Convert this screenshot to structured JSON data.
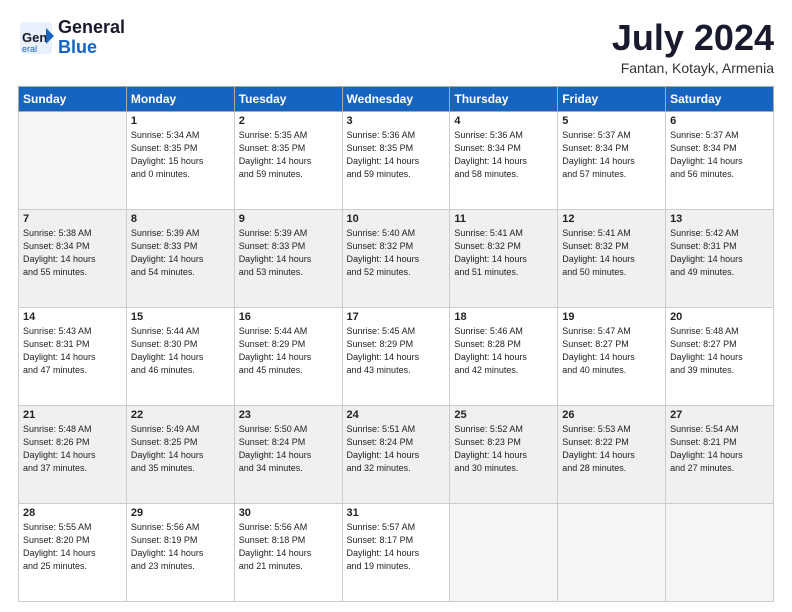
{
  "header": {
    "logo_line1": "General",
    "logo_line2": "Blue",
    "month": "July 2024",
    "location": "Fantan, Kotayk, Armenia"
  },
  "weekdays": [
    "Sunday",
    "Monday",
    "Tuesday",
    "Wednesday",
    "Thursday",
    "Friday",
    "Saturday"
  ],
  "weeks": [
    [
      {
        "day": "",
        "info": ""
      },
      {
        "day": "1",
        "info": "Sunrise: 5:34 AM\nSunset: 8:35 PM\nDaylight: 15 hours\nand 0 minutes."
      },
      {
        "day": "2",
        "info": "Sunrise: 5:35 AM\nSunset: 8:35 PM\nDaylight: 14 hours\nand 59 minutes."
      },
      {
        "day": "3",
        "info": "Sunrise: 5:36 AM\nSunset: 8:35 PM\nDaylight: 14 hours\nand 59 minutes."
      },
      {
        "day": "4",
        "info": "Sunrise: 5:36 AM\nSunset: 8:34 PM\nDaylight: 14 hours\nand 58 minutes."
      },
      {
        "day": "5",
        "info": "Sunrise: 5:37 AM\nSunset: 8:34 PM\nDaylight: 14 hours\nand 57 minutes."
      },
      {
        "day": "6",
        "info": "Sunrise: 5:37 AM\nSunset: 8:34 PM\nDaylight: 14 hours\nand 56 minutes."
      }
    ],
    [
      {
        "day": "7",
        "info": "Sunrise: 5:38 AM\nSunset: 8:34 PM\nDaylight: 14 hours\nand 55 minutes."
      },
      {
        "day": "8",
        "info": "Sunrise: 5:39 AM\nSunset: 8:33 PM\nDaylight: 14 hours\nand 54 minutes."
      },
      {
        "day": "9",
        "info": "Sunrise: 5:39 AM\nSunset: 8:33 PM\nDaylight: 14 hours\nand 53 minutes."
      },
      {
        "day": "10",
        "info": "Sunrise: 5:40 AM\nSunset: 8:32 PM\nDaylight: 14 hours\nand 52 minutes."
      },
      {
        "day": "11",
        "info": "Sunrise: 5:41 AM\nSunset: 8:32 PM\nDaylight: 14 hours\nand 51 minutes."
      },
      {
        "day": "12",
        "info": "Sunrise: 5:41 AM\nSunset: 8:32 PM\nDaylight: 14 hours\nand 50 minutes."
      },
      {
        "day": "13",
        "info": "Sunrise: 5:42 AM\nSunset: 8:31 PM\nDaylight: 14 hours\nand 49 minutes."
      }
    ],
    [
      {
        "day": "14",
        "info": "Sunrise: 5:43 AM\nSunset: 8:31 PM\nDaylight: 14 hours\nand 47 minutes."
      },
      {
        "day": "15",
        "info": "Sunrise: 5:44 AM\nSunset: 8:30 PM\nDaylight: 14 hours\nand 46 minutes."
      },
      {
        "day": "16",
        "info": "Sunrise: 5:44 AM\nSunset: 8:29 PM\nDaylight: 14 hours\nand 45 minutes."
      },
      {
        "day": "17",
        "info": "Sunrise: 5:45 AM\nSunset: 8:29 PM\nDaylight: 14 hours\nand 43 minutes."
      },
      {
        "day": "18",
        "info": "Sunrise: 5:46 AM\nSunset: 8:28 PM\nDaylight: 14 hours\nand 42 minutes."
      },
      {
        "day": "19",
        "info": "Sunrise: 5:47 AM\nSunset: 8:27 PM\nDaylight: 14 hours\nand 40 minutes."
      },
      {
        "day": "20",
        "info": "Sunrise: 5:48 AM\nSunset: 8:27 PM\nDaylight: 14 hours\nand 39 minutes."
      }
    ],
    [
      {
        "day": "21",
        "info": "Sunrise: 5:48 AM\nSunset: 8:26 PM\nDaylight: 14 hours\nand 37 minutes."
      },
      {
        "day": "22",
        "info": "Sunrise: 5:49 AM\nSunset: 8:25 PM\nDaylight: 14 hours\nand 35 minutes."
      },
      {
        "day": "23",
        "info": "Sunrise: 5:50 AM\nSunset: 8:24 PM\nDaylight: 14 hours\nand 34 minutes."
      },
      {
        "day": "24",
        "info": "Sunrise: 5:51 AM\nSunset: 8:24 PM\nDaylight: 14 hours\nand 32 minutes."
      },
      {
        "day": "25",
        "info": "Sunrise: 5:52 AM\nSunset: 8:23 PM\nDaylight: 14 hours\nand 30 minutes."
      },
      {
        "day": "26",
        "info": "Sunrise: 5:53 AM\nSunset: 8:22 PM\nDaylight: 14 hours\nand 28 minutes."
      },
      {
        "day": "27",
        "info": "Sunrise: 5:54 AM\nSunset: 8:21 PM\nDaylight: 14 hours\nand 27 minutes."
      }
    ],
    [
      {
        "day": "28",
        "info": "Sunrise: 5:55 AM\nSunset: 8:20 PM\nDaylight: 14 hours\nand 25 minutes."
      },
      {
        "day": "29",
        "info": "Sunrise: 5:56 AM\nSunset: 8:19 PM\nDaylight: 14 hours\nand 23 minutes."
      },
      {
        "day": "30",
        "info": "Sunrise: 5:56 AM\nSunset: 8:18 PM\nDaylight: 14 hours\nand 21 minutes."
      },
      {
        "day": "31",
        "info": "Sunrise: 5:57 AM\nSunset: 8:17 PM\nDaylight: 14 hours\nand 19 minutes."
      },
      {
        "day": "",
        "info": ""
      },
      {
        "day": "",
        "info": ""
      },
      {
        "day": "",
        "info": ""
      }
    ]
  ]
}
